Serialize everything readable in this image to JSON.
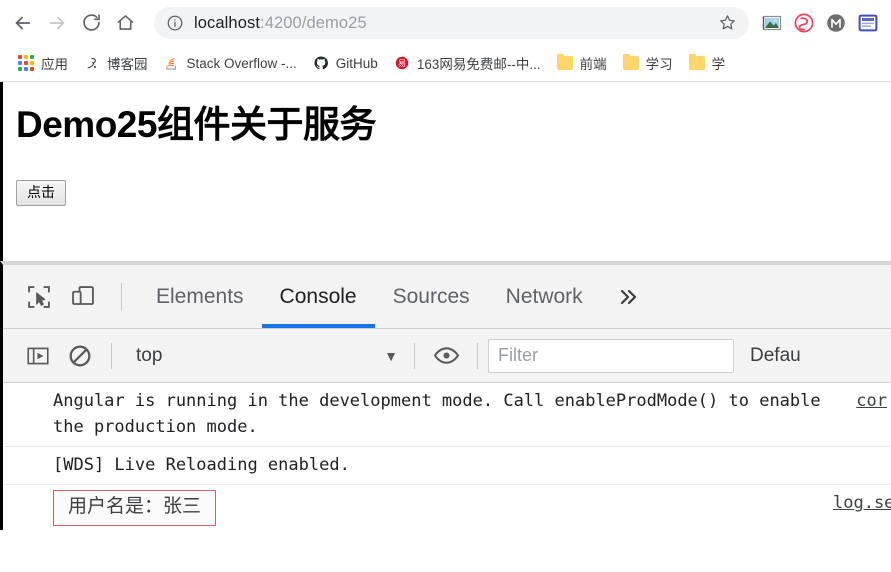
{
  "browser": {
    "nav": {
      "back_icon": "arrow-left-icon",
      "forward_icon": "arrow-right-icon",
      "reload_icon": "reload-icon",
      "home_icon": "home-icon"
    },
    "omnibox": {
      "info_icon": "page-info-icon",
      "url_host": "localhost",
      "url_path": ":4200/demo25",
      "url_full": "localhost:4200/demo25",
      "star_icon": "bookmark-star-icon"
    },
    "extensions": [
      {
        "name": "screenshot-extension-icon",
        "color": "#4a7fb5"
      },
      {
        "name": "openai-extension-icon",
        "color": "#e8445a"
      },
      {
        "name": "momentum-extension-icon",
        "color": "#6e6e6e"
      },
      {
        "name": "reader-extension-icon",
        "color": "#3f51b5"
      }
    ],
    "bookmarks": [
      {
        "label": "应用",
        "icon": "apps-grid-icon"
      },
      {
        "label": "博客园",
        "icon": "cnblogs-icon"
      },
      {
        "label": "Stack Overflow -...",
        "icon": "stackoverflow-icon"
      },
      {
        "label": "GitHub",
        "icon": "github-icon"
      },
      {
        "label": "163网易免费邮--中...",
        "icon": "netease-mail-icon"
      },
      {
        "label": "前端",
        "icon": "folder-icon"
      },
      {
        "label": "学习",
        "icon": "folder-icon"
      },
      {
        "label": "学",
        "icon": "folder-icon"
      }
    ]
  },
  "page": {
    "title": "Demo25组件关于服务",
    "button_label": "点击"
  },
  "devtools": {
    "inspect_icon": "inspect-element-icon",
    "device_icon": "device-toolbar-icon",
    "tabs": [
      {
        "label": "Elements",
        "active": false
      },
      {
        "label": "Console",
        "active": true
      },
      {
        "label": "Sources",
        "active": false
      },
      {
        "label": "Network",
        "active": false
      }
    ],
    "more_tabs_icon": "chevron-double-right-icon",
    "accent_color": "#1a73e8",
    "console_toolbar": {
      "sidebar_icon": "console-sidebar-icon",
      "clear_icon": "clear-console-icon",
      "context_value": "top",
      "context_arrow_icon": "chevron-down-icon",
      "eye_icon": "live-expression-eye-icon",
      "filter_placeholder": "Filter",
      "filter_value": "",
      "levels_label": "Defau"
    },
    "messages": [
      {
        "text": "Angular is running in the development mode. Call enableProdMode() to enable the production mode.",
        "source": "cor",
        "highlighted": false
      },
      {
        "text": "[WDS] Live Reloading enabled.",
        "source": "",
        "highlighted": false
      },
      {
        "text": "用户名是：张三",
        "source": "log.ser",
        "highlighted": true,
        "highlight_border_color": "#d95c68"
      }
    ]
  }
}
